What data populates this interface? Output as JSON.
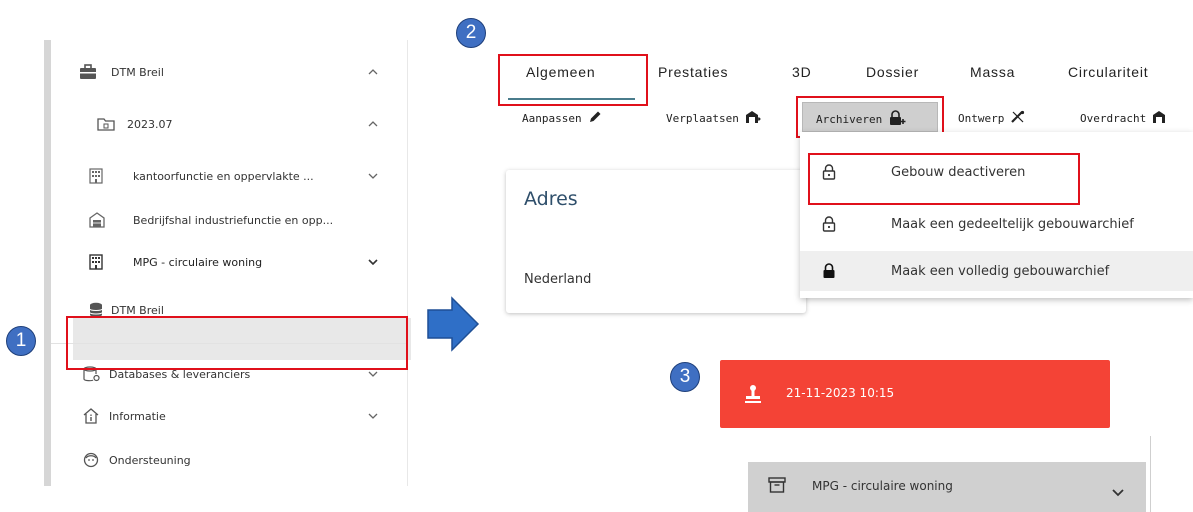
{
  "badges": [
    "1",
    "2",
    "3"
  ],
  "sidebar": {
    "project": {
      "label": "DTM Breil",
      "icon": "briefcase-icon"
    },
    "folder": {
      "label": "2023.07",
      "icon": "folder-icon"
    },
    "items": [
      {
        "label": "kantoorfunctie en oppervlakte ...",
        "icon": "building-icon"
      },
      {
        "label": "Bedrijfshal industriefunctie en opp...",
        "icon": "warehouse-icon"
      },
      {
        "label": "MPG - circulaire woning",
        "icon": "building-icon"
      }
    ],
    "database": {
      "label": "DTM Breil",
      "icon": "database-icon"
    },
    "sections": [
      {
        "label": "Databases & leveranciers",
        "icon": "database-settings-icon"
      },
      {
        "label": "Informatie",
        "icon": "info-house-icon"
      },
      {
        "label": "Ondersteuning",
        "icon": "support-face-icon"
      }
    ]
  },
  "tabs": [
    "Algemeen",
    "Prestaties",
    "3D",
    "Dossier",
    "Massa",
    "Circulariteit"
  ],
  "toolbar": {
    "aanpassen": "Aanpassen",
    "verplaatsen": "Verplaatsen",
    "archiveren": "Archiveren",
    "ontwerp": "Ontwerp",
    "overdracht": "Overdracht"
  },
  "card": {
    "title": "Adres",
    "country": "Nederland"
  },
  "archive_menu": [
    "Gebouw deactiveren",
    "Maak een gedeeltelijk gebouwarchief",
    "Maak een volledig gebouwarchief"
  ],
  "banner": {
    "text": "21-11-2023 10:15",
    "color": "#f44336"
  },
  "archived_item": {
    "label": "MPG - circulaire woning",
    "icon": "archive-box-icon"
  },
  "colors": {
    "highlight": "#e0101b",
    "badge": "#3f6fc2",
    "arrow": "#2f6fc7",
    "accent": "#4a7c8c"
  }
}
